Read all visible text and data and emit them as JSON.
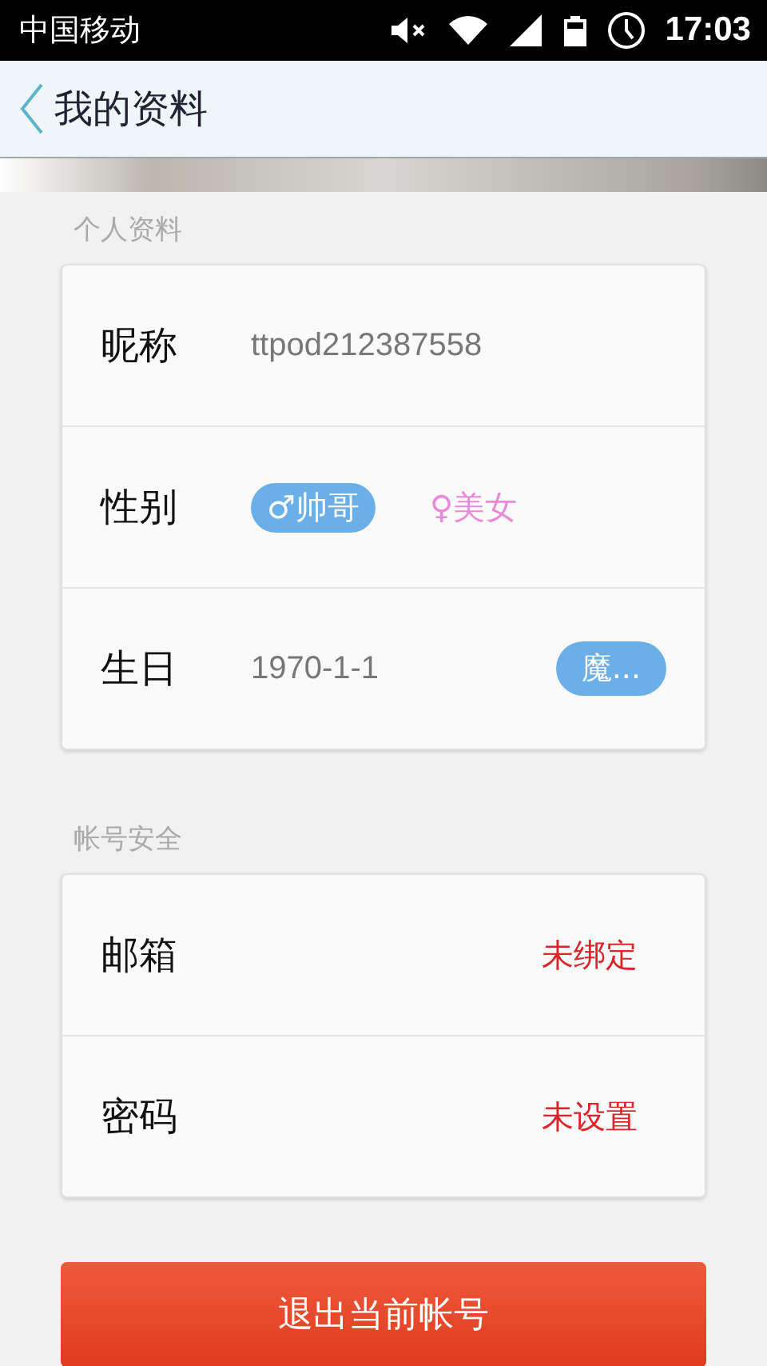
{
  "status_bar": {
    "carrier": "中国移动",
    "time": "17:03"
  },
  "header": {
    "title": "我的资料"
  },
  "profile": {
    "label": "个人资料",
    "nickname": {
      "label": "昵称",
      "value": "ttpod212387558"
    },
    "gender": {
      "label": "性别",
      "options": [
        {
          "label": "♂帅哥",
          "selected": true
        },
        {
          "label": "♀美女",
          "selected": false
        }
      ]
    },
    "birthday": {
      "label": "生日",
      "value": "1970-1-1",
      "sign": "魔..."
    }
  },
  "security": {
    "label": "帐号安全",
    "rows": [
      {
        "label": "邮箱",
        "value": "未绑定"
      },
      {
        "label": "密码",
        "value": "未设置"
      }
    ]
  },
  "logout_button": "退出当前帐号"
}
